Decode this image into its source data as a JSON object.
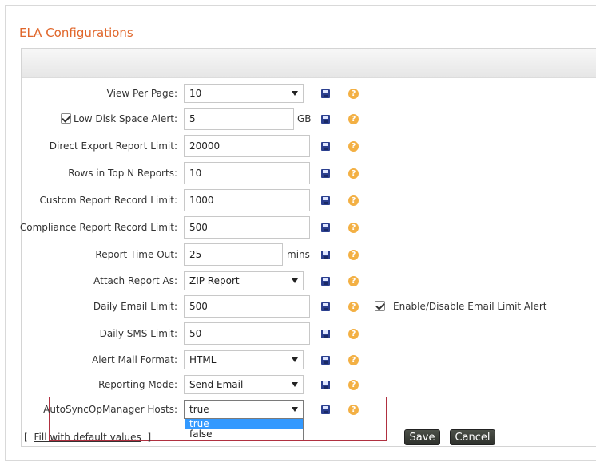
{
  "page": {
    "title": "ELA Configurations"
  },
  "rows": [
    {
      "label": "View Per Page:",
      "type": "select",
      "value": "10"
    },
    {
      "label": "Low Disk Space Alert:",
      "type": "input",
      "value": "5",
      "unit": "GB",
      "checked": true
    },
    {
      "label": "Direct Export Report Limit:",
      "type": "input",
      "value": "20000"
    },
    {
      "label": "Rows in Top N Reports:",
      "type": "input",
      "value": "10"
    },
    {
      "label": "Custom Report Record Limit:",
      "type": "input",
      "value": "1000"
    },
    {
      "label": "Compliance Report Record Limit:",
      "type": "input",
      "value": "500"
    },
    {
      "label": "Report Time Out:",
      "type": "input",
      "value": "25",
      "unit": "mins"
    },
    {
      "label": "Attach Report As:",
      "type": "select",
      "value": "ZIP Report"
    },
    {
      "label": "Daily Email Limit:",
      "type": "input",
      "value": "500",
      "extra_label": "Enable/Disable Email Limit Alert",
      "extra_checked": true
    },
    {
      "label": "Daily SMS Limit:",
      "type": "input",
      "value": "50"
    },
    {
      "label": "Alert Mail Format:",
      "type": "select",
      "value": "HTML"
    },
    {
      "label": "Reporting Mode:",
      "type": "select",
      "value": "Send Email"
    },
    {
      "label": "AutoSyncOpManager Hosts:",
      "type": "select",
      "value": "true",
      "options": [
        "true",
        "false"
      ]
    }
  ],
  "icons": {
    "save": "save-icon",
    "help": "help-icon",
    "help_glyph": "?"
  },
  "footer": {
    "bracket_open": "[",
    "fill_default": "Fill with default values",
    "bracket_close": "]",
    "save_label": "Save",
    "cancel_label": "Cancel"
  },
  "colors": {
    "title": "#e0662a",
    "highlight": "#b03040",
    "selected_option": "#3399ff"
  }
}
